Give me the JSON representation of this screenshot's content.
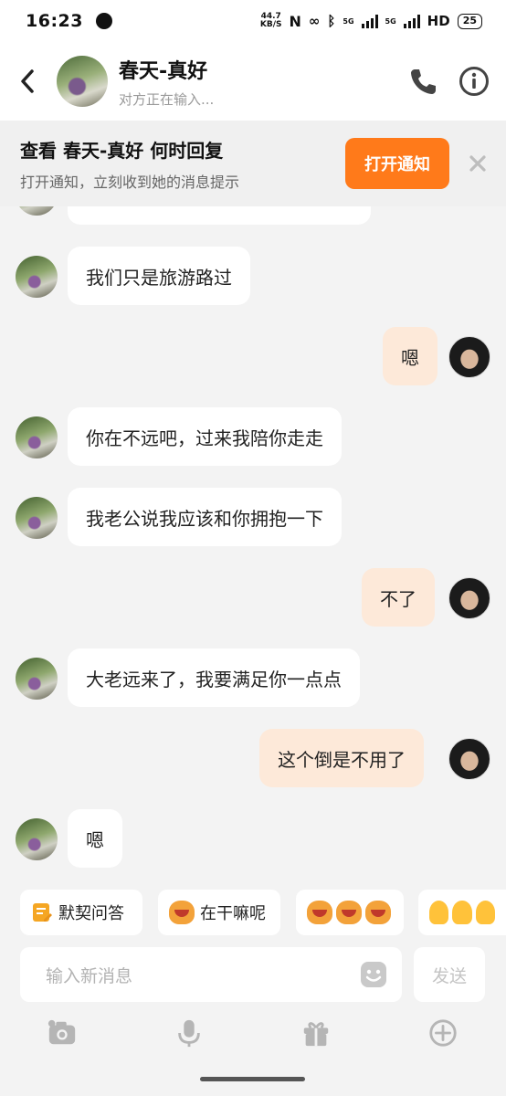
{
  "status_bar": {
    "time": "16:23",
    "net_speed_value": "44.7",
    "net_speed_unit": "KB/S",
    "net_type_1": "5G",
    "net_type_2": "5G",
    "hd_label": "HD",
    "battery": "25"
  },
  "header": {
    "contact_name": "春天-真好",
    "contact_status": "对方正在输入..."
  },
  "notification": {
    "title": "查看 春天-真好 何时回复",
    "subtitle": "打开通知，立刻收到她的消息提示",
    "button_label": "打开通知"
  },
  "messages": [
    {
      "side": "in",
      "text": ""
    },
    {
      "side": "in",
      "text": "我们只是旅游路过"
    },
    {
      "side": "out",
      "text": "嗯"
    },
    {
      "side": "in",
      "text": "你在不远吧，过来我陪你走走"
    },
    {
      "side": "in",
      "text": "我老公说我应该和你拥抱一下"
    },
    {
      "side": "out",
      "text": "不了"
    },
    {
      "side": "in",
      "text": "大老远来了，我要满足你一点点"
    },
    {
      "side": "out",
      "text": "这个倒是不用了"
    },
    {
      "side": "in",
      "text": "嗯"
    }
  ],
  "quick_replies": [
    {
      "label": "默契问答",
      "icon": "quiz-icon"
    },
    {
      "label": "在干嘛呢",
      "icon": "tiger-emoji-icon"
    },
    {
      "label": "",
      "icon": "frog-emoji-icon"
    },
    {
      "label": "",
      "icon": "wave-emoji-icon"
    }
  ],
  "composer": {
    "placeholder": "输入新消息",
    "send_label": "发送"
  },
  "toolbar": {
    "items": [
      "camera-icon",
      "microphone-icon",
      "gift-icon",
      "plus-circle-icon"
    ]
  },
  "colors": {
    "accent": "#ff7a1a",
    "outgoing_bubble": "#fde9d9",
    "incoming_bubble": "#ffffff",
    "background": "#f3f3f3"
  }
}
